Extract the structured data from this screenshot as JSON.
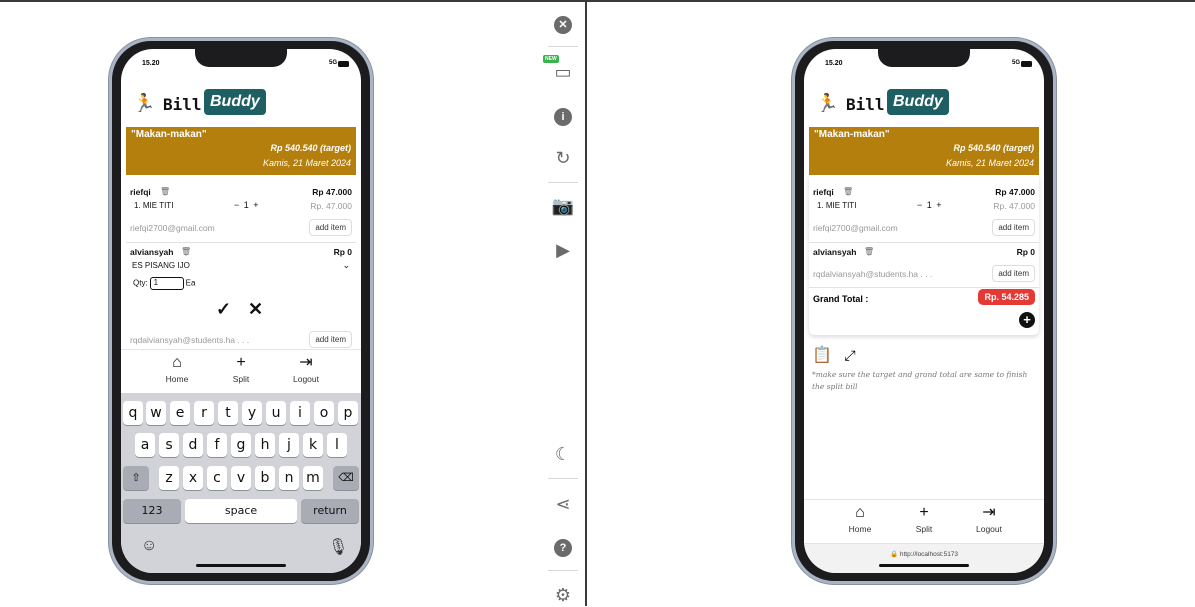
{
  "brand": {
    "bill": "Bill",
    "buddy": "Buddy"
  },
  "status": {
    "time": "15.20",
    "network": "5G"
  },
  "group": {
    "name": "\"Makan-makan\"",
    "target": "Rp 540.540 (target)",
    "date": "Kamis, 21 Maret 2024"
  },
  "members": [
    {
      "name": "riefqi",
      "total": "Rp 47.000",
      "item": "1. MIE TITI",
      "qty": "1",
      "item_price": "Rp. 47.000",
      "email": "riefqi2700@gmail.com",
      "add_item": "add item"
    },
    {
      "name": "alviansyah",
      "total": "Rp 0",
      "email": "rqdalviansyah@students.ha . . .",
      "add_item": "add item"
    }
  ],
  "add_form": {
    "selected_item": "ES PISANG IJO",
    "qty_label": "Qty:",
    "qty_value": "1",
    "unit": "Ea",
    "confirm": "✓",
    "cancel": "✕"
  },
  "nav": {
    "home": "Home",
    "split": "Split",
    "logout": "Logout"
  },
  "keyboard": {
    "row1": [
      "q",
      "w",
      "e",
      "r",
      "t",
      "y",
      "u",
      "i",
      "o",
      "p"
    ],
    "row2": [
      "a",
      "s",
      "d",
      "f",
      "g",
      "h",
      "j",
      "k",
      "l"
    ],
    "row3": [
      "z",
      "x",
      "c",
      "v",
      "b",
      "n",
      "m"
    ],
    "numbers": "123",
    "space": "space",
    "return": "return"
  },
  "summary": {
    "grand_total_label": "Grand Total :",
    "grand_total_value": "Rp. 54.285",
    "plus": "+"
  },
  "note": "*make sure the target and grand total are same to finish the split bill",
  "url": "http://localhost:5173",
  "toolbar_icons": [
    "close-icon",
    "devices-icon",
    "info-icon",
    "rotate-icon",
    "camera-icon",
    "video-icon",
    "moon-icon",
    "share-icon",
    "help-icon",
    "settings-icon"
  ],
  "toolbar_badge": "NEW",
  "colors": {
    "banner": "#b47f0c",
    "brand_teal": "#1e5f63",
    "grand_total_badge": "#e53935"
  }
}
